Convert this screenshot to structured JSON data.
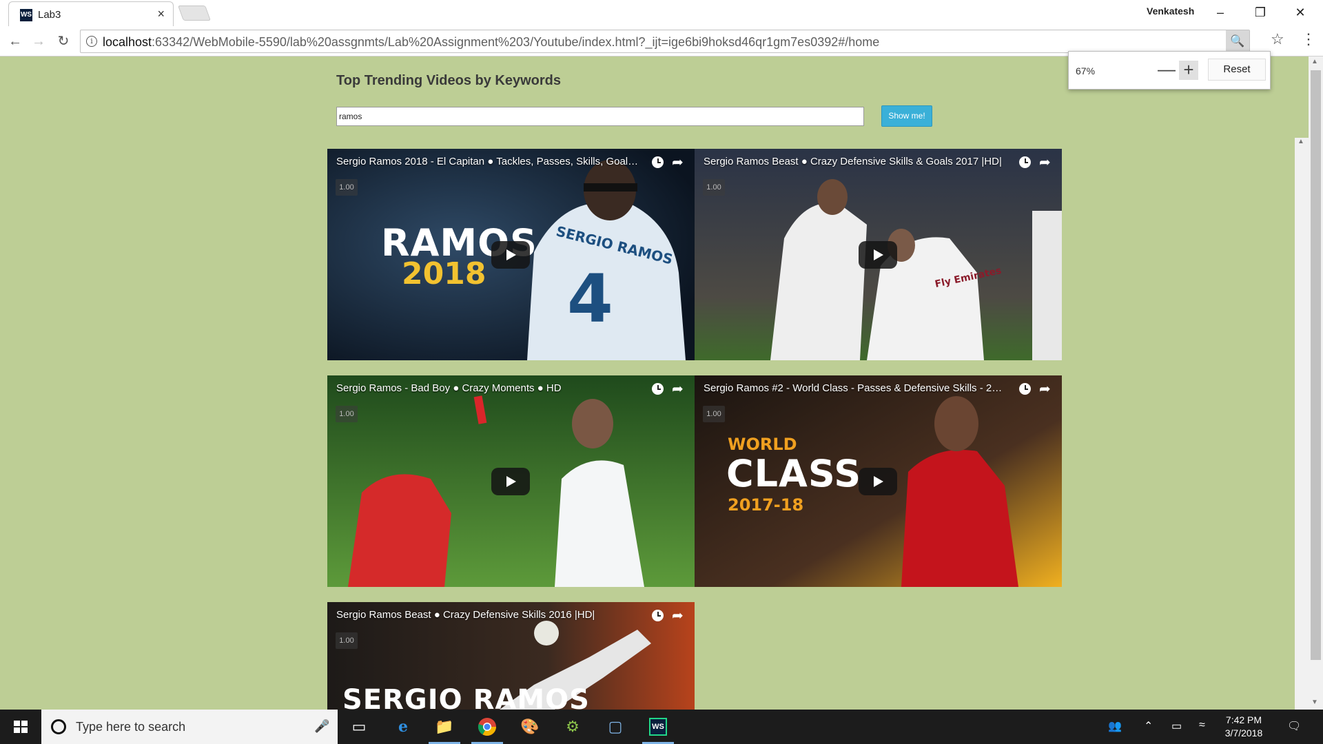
{
  "browser": {
    "tab_favicon": "WS",
    "tab_title": "Lab3",
    "tab_close": "×",
    "profile_name": "Venkatesh",
    "url_host": "localhost",
    "url_rest": ":63342/WebMobile-5590/lab%20assgnmts/Lab%20Assignment%203/Youtube/index.html?_ijt=ige6bi9hoksd46qr1gm7es0392#/home"
  },
  "zoom_popup": {
    "level": "67%",
    "minus": "—",
    "plus": "+",
    "reset": "Reset"
  },
  "page": {
    "title": "Top Trending Videos by Keywords",
    "search_value": "ramos",
    "button_label": "Show me!"
  },
  "videos": [
    {
      "title": "Sergio Ramos 2018 - El Capitan ● Tackles, Passes, Skills, Goals ● ...",
      "speed": "1.00",
      "overlay_main": "RAMOS",
      "overlay_sub": "2018",
      "jersey_name": "SERGIO RAMOS",
      "jersey_number": "4"
    },
    {
      "title": "Sergio Ramos Beast ● Crazy Defensive Skills & Goals 2017 |HD|",
      "speed": "1.00",
      "jersey_text": "Fly Emirates"
    },
    {
      "title": "Sergio Ramos - Bad Boy ● Crazy Moments ● HD",
      "speed": "1.00"
    },
    {
      "title": "Sergio Ramos #2 - World Class - Passes & Defensive Skills - 2017/...",
      "speed": "1.00",
      "overlay_top": "WORLD",
      "overlay_main": "CLASS",
      "overlay_sub": "2017-18"
    },
    {
      "title": "Sergio Ramos Beast ● Crazy Defensive Skills 2016 |HD|",
      "speed": "1.00",
      "overlay_main": "SERGIO RAMOS"
    }
  ],
  "taskbar": {
    "search_placeholder": "Type here to search",
    "time": "7:42 PM",
    "date": "3/7/2018",
    "apps": [
      "task-view-icon",
      "edge-icon",
      "file-explorer-icon",
      "chrome-icon",
      "paint-icon",
      "android-studio-icon",
      "virtualbox-icon",
      "webstorm-icon"
    ]
  }
}
